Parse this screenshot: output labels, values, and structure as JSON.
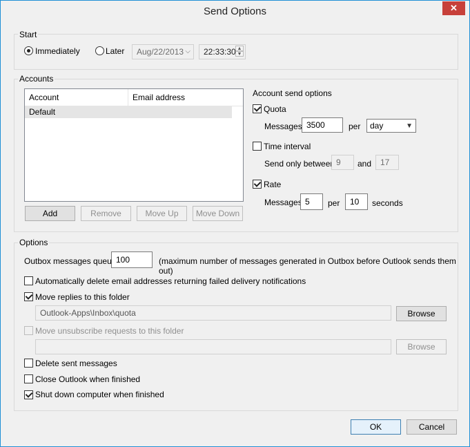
{
  "window": {
    "title": "Send Options",
    "close_glyph": "✕"
  },
  "start": {
    "label": "Start",
    "immediately": "Immediately",
    "later": "Later",
    "date": "Aug/22/2013",
    "time": "22:33:30"
  },
  "accounts": {
    "label": "Accounts",
    "columns": [
      "Account",
      "Email address"
    ],
    "rows": [
      {
        "account": "Default",
        "email": ""
      }
    ],
    "buttons": {
      "add": "Add",
      "remove": "Remove",
      "move_up": "Move Up",
      "move_down": "Move Down"
    },
    "send_options": {
      "title": "Account send options",
      "quota_label": "Quota",
      "messages_label": "Messages",
      "quota_value": "3500",
      "per": "per",
      "period": "day",
      "time_interval_label": "Time interval",
      "send_only_between": "Send only between",
      "interval_from": "9",
      "and": "and",
      "interval_to": "17",
      "rate_label": "Rate",
      "rate_messages": "5",
      "rate_seconds": "10",
      "seconds": "seconds"
    }
  },
  "options": {
    "label": "Options",
    "queue_label": "Outbox messages queue",
    "queue_value": "100",
    "queue_note": "(maximum number of messages generated in Outbox before Outlook sends them out)",
    "auto_delete": "Automatically delete email addresses returning failed delivery notifications",
    "move_replies": "Move replies to this folder",
    "replies_folder": "Outlook-Apps\\Inbox\\quota",
    "browse": "Browse",
    "move_unsub": "Move unsubscribe requests to this folder",
    "unsub_folder": "",
    "delete_sent": "Delete sent messages",
    "close_outlook": "Close Outlook when finished",
    "shutdown": "Shut down computer when finished"
  },
  "footer": {
    "ok": "OK",
    "cancel": "Cancel"
  }
}
